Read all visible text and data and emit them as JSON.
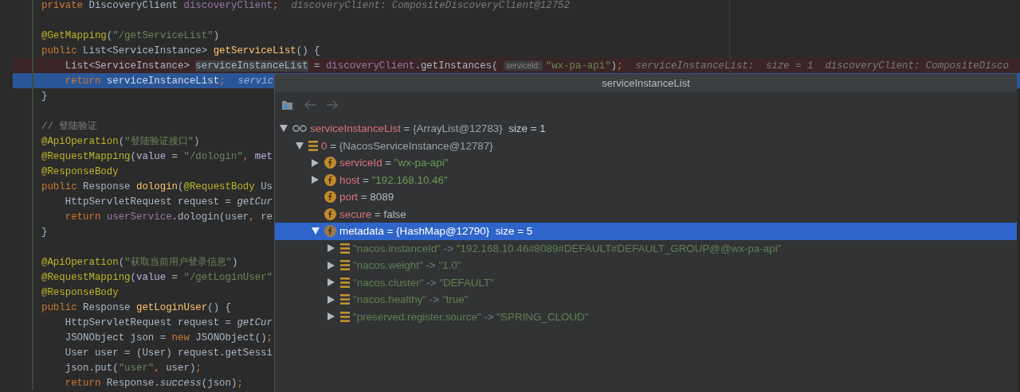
{
  "editor": {
    "lines": [
      {
        "breakpoint": false,
        "current": false,
        "segments": [
          {
            "kind": "code",
            "tokens": [
              {
                "kind": "kw",
                "text": "private "
              },
              {
                "kind": "plain",
                "text": "DiscoveryClient "
              },
              {
                "kind": "field",
                "text": "discoveryClient"
              },
              {
                "kind": "kw",
                "text": ";"
              }
            ]
          },
          {
            "kind": "hint",
            "text": "discoveryClient: CompositeDiscoveryClient@12752"
          }
        ]
      },
      {
        "breakpoint": false,
        "current": false
      },
      {
        "breakpoint": false,
        "current": false,
        "segments": [
          {
            "kind": "code",
            "tokens": [
              {
                "kind": "annot",
                "text": "@GetMapping"
              },
              {
                "kind": "plain",
                "text": "("
              },
              {
                "kind": "string",
                "text": "\"/getServiceList\""
              },
              {
                "kind": "plain",
                "text": ")"
              }
            ]
          }
        ]
      },
      {
        "breakpoint": false,
        "current": false,
        "segments": [
          {
            "kind": "code",
            "tokens": [
              {
                "kind": "kw",
                "text": "public "
              },
              {
                "kind": "plain",
                "text": "List<ServiceInstance> "
              },
              {
                "kind": "method",
                "text": "getServiceList"
              },
              {
                "kind": "plain",
                "text": "() {"
              }
            ]
          }
        ]
      },
      {
        "breakpoint": true,
        "current": false,
        "segments": [
          {
            "kind": "code",
            "tokens": [
              {
                "kind": "plain",
                "text": "    List<ServiceInstance> "
              },
              {
                "kind": "highlight",
                "text": "serviceInstanceList"
              },
              {
                "kind": "plain",
                "text": " = "
              },
              {
                "kind": "field",
                "text": "discoveryClient"
              },
              {
                "kind": "plain",
                "text": ".getInstances( "
              }
            ]
          },
          {
            "kind": "chip",
            "text": "serviceId:"
          },
          {
            "kind": "code",
            "tokens": [
              {
                "kind": "string",
                "text": "\"wx-pa-api\""
              },
              {
                "kind": "plain",
                "text": ")"
              },
              {
                "kind": "kw",
                "text": ";"
              }
            ]
          },
          {
            "kind": "hint",
            "text": "serviceInstanceList:  size = 1  discoveryClient: CompositeDisco"
          }
        ]
      },
      {
        "breakpoint": false,
        "current": true,
        "segments": [
          {
            "kind": "code",
            "tokens": [
              {
                "kind": "kw",
                "text": "    return "
              },
              {
                "kind": "plain",
                "text": "serviceInstanceList"
              },
              {
                "kind": "kw",
                "text": ";"
              }
            ]
          },
          {
            "kind": "hint",
            "text": "servic"
          }
        ]
      },
      {
        "breakpoint": false,
        "current": false,
        "segments": [
          {
            "kind": "code",
            "tokens": [
              {
                "kind": "plain",
                "text": "}"
              }
            ]
          }
        ]
      },
      {
        "breakpoint": false,
        "current": false
      },
      {
        "breakpoint": false,
        "current": false,
        "segments": [
          {
            "kind": "code",
            "tokens": [
              {
                "kind": "comment",
                "text": "// 登陆验证"
              }
            ]
          }
        ]
      },
      {
        "breakpoint": false,
        "current": false,
        "segments": [
          {
            "kind": "code",
            "tokens": [
              {
                "kind": "annot",
                "text": "@ApiOperation"
              },
              {
                "kind": "plain",
                "text": "("
              },
              {
                "kind": "string",
                "text": "\"登陆验证接口\""
              },
              {
                "kind": "plain",
                "text": ")"
              }
            ]
          }
        ]
      },
      {
        "breakpoint": false,
        "current": false,
        "segments": [
          {
            "kind": "code",
            "tokens": [
              {
                "kind": "annot",
                "text": "@RequestMapping"
              },
              {
                "kind": "plain",
                "text": "("
              },
              {
                "kind": "param",
                "text": "value"
              },
              {
                "kind": "plain",
                "text": " = "
              },
              {
                "kind": "string",
                "text": "\"/dologin\""
              },
              {
                "kind": "kw",
                "text": ", "
              },
              {
                "kind": "param",
                "text": "met"
              }
            ]
          }
        ]
      },
      {
        "breakpoint": false,
        "current": false,
        "segments": [
          {
            "kind": "code",
            "tokens": [
              {
                "kind": "annot",
                "text": "@ResponseBody"
              }
            ]
          }
        ]
      },
      {
        "breakpoint": false,
        "current": false,
        "segments": [
          {
            "kind": "code",
            "tokens": [
              {
                "kind": "kw",
                "text": "public "
              },
              {
                "kind": "plain",
                "text": "Response "
              },
              {
                "kind": "method",
                "text": "dologin"
              },
              {
                "kind": "plain",
                "text": "("
              },
              {
                "kind": "annot",
                "text": "@RequestBody"
              },
              {
                "kind": "plain",
                "text": " Us"
              }
            ]
          }
        ]
      },
      {
        "breakpoint": false,
        "current": false,
        "segments": [
          {
            "kind": "code",
            "tokens": [
              {
                "kind": "plain",
                "text": "    HttpServletRequest request = "
              },
              {
                "kind": "italic",
                "text": "getCur"
              }
            ]
          }
        ]
      },
      {
        "breakpoint": false,
        "current": false,
        "segments": [
          {
            "kind": "code",
            "tokens": [
              {
                "kind": "kw",
                "text": "    return "
              },
              {
                "kind": "field",
                "text": "userService"
              },
              {
                "kind": "plain",
                "text": ".dologin(user"
              },
              {
                "kind": "kw",
                "text": ", "
              },
              {
                "kind": "plain",
                "text": "re"
              }
            ]
          }
        ]
      },
      {
        "breakpoint": false,
        "current": false,
        "segments": [
          {
            "kind": "code",
            "tokens": [
              {
                "kind": "plain",
                "text": "}"
              }
            ]
          }
        ]
      },
      {
        "breakpoint": false,
        "current": false
      },
      {
        "breakpoint": false,
        "current": false,
        "segments": [
          {
            "kind": "code",
            "tokens": [
              {
                "kind": "annot",
                "text": "@ApiOperation"
              },
              {
                "kind": "plain",
                "text": "("
              },
              {
                "kind": "string",
                "text": "\"获取当前用户登录信息\""
              },
              {
                "kind": "plain",
                "text": ")"
              }
            ]
          }
        ]
      },
      {
        "breakpoint": false,
        "current": false,
        "segments": [
          {
            "kind": "code",
            "tokens": [
              {
                "kind": "annot",
                "text": "@RequestMapping"
              },
              {
                "kind": "plain",
                "text": "("
              },
              {
                "kind": "param",
                "text": "value"
              },
              {
                "kind": "plain",
                "text": " = "
              },
              {
                "kind": "string",
                "text": "\"/getLoginUser\""
              }
            ]
          }
        ]
      },
      {
        "breakpoint": false,
        "current": false,
        "segments": [
          {
            "kind": "code",
            "tokens": [
              {
                "kind": "annot",
                "text": "@ResponseBody"
              }
            ]
          }
        ]
      },
      {
        "breakpoint": false,
        "current": false,
        "segments": [
          {
            "kind": "code",
            "tokens": [
              {
                "kind": "kw",
                "text": "public "
              },
              {
                "kind": "plain",
                "text": "Response "
              },
              {
                "kind": "method",
                "text": "getLoginUser"
              },
              {
                "kind": "plain",
                "text": "() {"
              }
            ]
          }
        ]
      },
      {
        "breakpoint": false,
        "current": false,
        "segments": [
          {
            "kind": "code",
            "tokens": [
              {
                "kind": "plain",
                "text": "    HttpServletRequest request = "
              },
              {
                "kind": "italic",
                "text": "getCur"
              }
            ]
          }
        ]
      },
      {
        "breakpoint": false,
        "current": false,
        "segments": [
          {
            "kind": "code",
            "tokens": [
              {
                "kind": "plain",
                "text": "    JSONObject json = "
              },
              {
                "kind": "kw",
                "text": "new "
              },
              {
                "kind": "plain",
                "text": "JSONObject()"
              },
              {
                "kind": "kw",
                "text": ";"
              }
            ]
          }
        ]
      },
      {
        "breakpoint": false,
        "current": false,
        "segments": [
          {
            "kind": "code",
            "tokens": [
              {
                "kind": "plain",
                "text": "    User user = (User) request.getSessi"
              }
            ]
          }
        ]
      },
      {
        "breakpoint": false,
        "current": false,
        "segments": [
          {
            "kind": "code",
            "tokens": [
              {
                "kind": "plain",
                "text": "    json.put("
              },
              {
                "kind": "string",
                "text": "\"user\""
              },
              {
                "kind": "kw",
                "text": ", "
              },
              {
                "kind": "plain",
                "text": "user)"
              },
              {
                "kind": "kw",
                "text": ";"
              }
            ]
          }
        ]
      },
      {
        "breakpoint": false,
        "current": false,
        "segments": [
          {
            "kind": "code",
            "tokens": [
              {
                "kind": "kw",
                "text": "    return "
              },
              {
                "kind": "plain",
                "text": "Response."
              },
              {
                "kind": "italic",
                "text": "success"
              },
              {
                "kind": "plain",
                "text": "(json)"
              },
              {
                "kind": "kw",
                "text": ";"
              }
            ]
          }
        ]
      }
    ]
  },
  "popup": {
    "title": "serviceInstanceList",
    "toolbar": [
      {
        "kind": "folder",
        "disabled": false
      },
      {
        "kind": "back",
        "disabled": true
      },
      {
        "kind": "forward",
        "disabled": true
      }
    ],
    "tree": [
      {
        "kind": "variable",
        "name": "serviceInstanceList",
        "separator": "=",
        "value": {
          "kind": "object",
          "text": "{ArrayList@12783}"
        },
        "extra": "size = 1",
        "expanded": true,
        "selected": false,
        "children": [
          {
            "kind": "array",
            "name": "0",
            "separator": "=",
            "value": {
              "kind": "object",
              "text": "{NacosServiceInstance@12787}"
            },
            "expanded": true,
            "selected": false,
            "children": [
              {
                "kind": "field",
                "name": "serviceId",
                "separator": "=",
                "value": {
                  "kind": "string",
                  "text": "\"wx-pa-api\""
                },
                "expanded": false,
                "selected": false
              },
              {
                "kind": "field",
                "name": "host",
                "separator": "=",
                "value": {
                  "kind": "string",
                  "text": "\"192.168.10.46\""
                },
                "expanded": false,
                "selected": false
              },
              {
                "kind": "field",
                "name": "port",
                "separator": "=",
                "value": {
                  "kind": "primitive",
                  "text": "8089"
                },
                "selected": false
              },
              {
                "kind": "field",
                "name": "secure",
                "separator": "=",
                "value": {
                  "kind": "primitive",
                  "text": "false"
                },
                "selected": false
              },
              {
                "kind": "field",
                "name": "metadata",
                "separator": "=",
                "value": {
                  "kind": "object",
                  "text": "{HashMap@12790}"
                },
                "extra": "size = 5",
                "expanded": true,
                "selected": true,
                "children": [
                  {
                    "kind": "entry",
                    "name": "\"nacos.instanceId\"",
                    "separator": "->",
                    "value": {
                      "kind": "string",
                      "text": "\"192.168.10.46#8089#DEFAULT#DEFAULT_GROUP@@wx-pa-api\""
                    },
                    "expanded": false,
                    "selected": false
                  },
                  {
                    "kind": "entry",
                    "name": "\"nacos.weight\"",
                    "separator": "->",
                    "value": {
                      "kind": "string",
                      "text": "\"1.0\""
                    },
                    "expanded": false,
                    "selected": false
                  },
                  {
                    "kind": "entry",
                    "name": "\"nacos.cluster\"",
                    "separator": "->",
                    "value": {
                      "kind": "string",
                      "text": "\"DEFAULT\""
                    },
                    "expanded": false,
                    "selected": false
                  },
                  {
                    "kind": "entry",
                    "name": "\"nacos.healthy\"",
                    "separator": "->",
                    "value": {
                      "kind": "string",
                      "text": "\"true\""
                    },
                    "expanded": false,
                    "selected": false
                  },
                  {
                    "kind": "entry",
                    "name": "\"preserved.register.source\"",
                    "separator": "->",
                    "value": {
                      "kind": "string",
                      "text": "\"SPRING_CLOUD\""
                    },
                    "expanded": false,
                    "selected": false
                  }
                ]
              }
            ]
          }
        ]
      }
    ]
  }
}
